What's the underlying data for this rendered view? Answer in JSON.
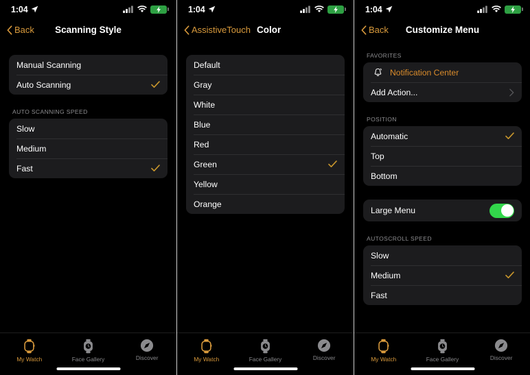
{
  "statusbar": {
    "time": "1:04",
    "location_icon": "location-arrow-icon",
    "cellular_icon": "cellular-signal-icon",
    "wifi_icon": "wifi-icon",
    "battery_icon": "battery-charging-icon"
  },
  "tabbar": {
    "tabs": [
      {
        "label": "My Watch",
        "icon": "watch-icon",
        "active": true
      },
      {
        "label": "Face Gallery",
        "icon": "watch-face-icon",
        "active": false
      },
      {
        "label": "Discover",
        "icon": "compass-icon",
        "active": false
      }
    ]
  },
  "colors": {
    "accent": "#d99a3c",
    "checkmark": "#c8962c",
    "toggle_on": "#32d74b",
    "card_bg": "#1c1c1e",
    "page_bg": "#000000",
    "group_header": "#8c8c8f"
  },
  "panel1": {
    "nav": {
      "back_label": "Back",
      "title": "Scanning Style"
    },
    "group1": {
      "rows": [
        {
          "label": "Manual Scanning",
          "checked": false
        },
        {
          "label": "Auto Scanning",
          "checked": true
        }
      ]
    },
    "group2": {
      "header": "AUTO SCANNING SPEED",
      "rows": [
        {
          "label": "Slow",
          "checked": false
        },
        {
          "label": "Medium",
          "checked": false
        },
        {
          "label": "Fast",
          "checked": true
        }
      ]
    }
  },
  "panel2": {
    "nav": {
      "back_label": "AssistiveTouch",
      "title": "Color"
    },
    "group1": {
      "rows": [
        {
          "label": "Default",
          "checked": false
        },
        {
          "label": "Gray",
          "checked": false
        },
        {
          "label": "White",
          "checked": false
        },
        {
          "label": "Blue",
          "checked": false
        },
        {
          "label": "Red",
          "checked": false
        },
        {
          "label": "Green",
          "checked": true
        },
        {
          "label": "Yellow",
          "checked": false
        },
        {
          "label": "Orange",
          "checked": false
        }
      ]
    }
  },
  "panel3": {
    "nav": {
      "back_label": "Back",
      "title": "Customize Menu"
    },
    "favorites": {
      "header": "FAVORITES",
      "rows": [
        {
          "label": "Notification Center",
          "icon": "bell-icon",
          "accent": true
        },
        {
          "label": "Add Action...",
          "chevron": true
        }
      ]
    },
    "position": {
      "header": "POSITION",
      "rows": [
        {
          "label": "Automatic",
          "checked": true
        },
        {
          "label": "Top",
          "checked": false
        },
        {
          "label": "Bottom",
          "checked": false
        }
      ]
    },
    "large_menu": {
      "label": "Large Menu",
      "enabled": true
    },
    "autoscroll": {
      "header": "AUTOSCROLL SPEED",
      "rows": [
        {
          "label": "Slow",
          "checked": false
        },
        {
          "label": "Medium",
          "checked": true
        },
        {
          "label": "Fast",
          "checked": false
        }
      ]
    }
  }
}
